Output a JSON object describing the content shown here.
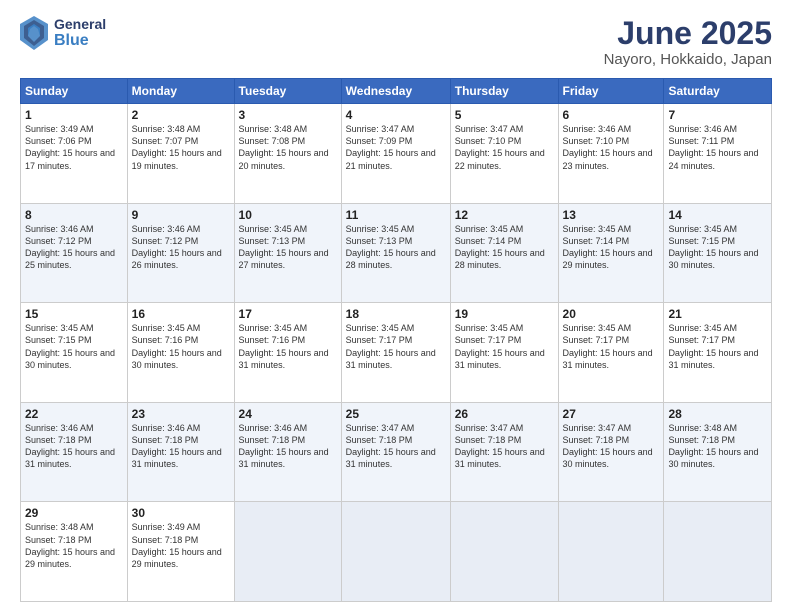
{
  "header": {
    "logo_general": "General",
    "logo_blue": "Blue",
    "title": "June 2025",
    "subtitle": "Nayoro, Hokkaido, Japan"
  },
  "calendar": {
    "days_of_week": [
      "Sunday",
      "Monday",
      "Tuesday",
      "Wednesday",
      "Thursday",
      "Friday",
      "Saturday"
    ],
    "weeks": [
      [
        null,
        {
          "day": 2,
          "info": "Sunrise: 3:48 AM\nSunset: 7:07 PM\nDaylight: 15 hours\nand 19 minutes."
        },
        {
          "day": 3,
          "info": "Sunrise: 3:48 AM\nSunset: 7:08 PM\nDaylight: 15 hours\nand 20 minutes."
        },
        {
          "day": 4,
          "info": "Sunrise: 3:47 AM\nSunset: 7:09 PM\nDaylight: 15 hours\nand 21 minutes."
        },
        {
          "day": 5,
          "info": "Sunrise: 3:47 AM\nSunset: 7:10 PM\nDaylight: 15 hours\nand 22 minutes."
        },
        {
          "day": 6,
          "info": "Sunrise: 3:46 AM\nSunset: 7:10 PM\nDaylight: 15 hours\nand 23 minutes."
        },
        {
          "day": 7,
          "info": "Sunrise: 3:46 AM\nSunset: 7:11 PM\nDaylight: 15 hours\nand 24 minutes."
        }
      ],
      [
        {
          "day": 1,
          "info": "Sunrise: 3:49 AM\nSunset: 7:06 PM\nDaylight: 15 hours\nand 17 minutes."
        },
        null,
        null,
        null,
        null,
        null,
        null
      ],
      [
        {
          "day": 8,
          "info": "Sunrise: 3:46 AM\nSunset: 7:12 PM\nDaylight: 15 hours\nand 25 minutes."
        },
        {
          "day": 9,
          "info": "Sunrise: 3:46 AM\nSunset: 7:12 PM\nDaylight: 15 hours\nand 26 minutes."
        },
        {
          "day": 10,
          "info": "Sunrise: 3:45 AM\nSunset: 7:13 PM\nDaylight: 15 hours\nand 27 minutes."
        },
        {
          "day": 11,
          "info": "Sunrise: 3:45 AM\nSunset: 7:13 PM\nDaylight: 15 hours\nand 28 minutes."
        },
        {
          "day": 12,
          "info": "Sunrise: 3:45 AM\nSunset: 7:14 PM\nDaylight: 15 hours\nand 28 minutes."
        },
        {
          "day": 13,
          "info": "Sunrise: 3:45 AM\nSunset: 7:14 PM\nDaylight: 15 hours\nand 29 minutes."
        },
        {
          "day": 14,
          "info": "Sunrise: 3:45 AM\nSunset: 7:15 PM\nDaylight: 15 hours\nand 30 minutes."
        }
      ],
      [
        {
          "day": 15,
          "info": "Sunrise: 3:45 AM\nSunset: 7:15 PM\nDaylight: 15 hours\nand 30 minutes."
        },
        {
          "day": 16,
          "info": "Sunrise: 3:45 AM\nSunset: 7:16 PM\nDaylight: 15 hours\nand 30 minutes."
        },
        {
          "day": 17,
          "info": "Sunrise: 3:45 AM\nSunset: 7:16 PM\nDaylight: 15 hours\nand 31 minutes."
        },
        {
          "day": 18,
          "info": "Sunrise: 3:45 AM\nSunset: 7:17 PM\nDaylight: 15 hours\nand 31 minutes."
        },
        {
          "day": 19,
          "info": "Sunrise: 3:45 AM\nSunset: 7:17 PM\nDaylight: 15 hours\nand 31 minutes."
        },
        {
          "day": 20,
          "info": "Sunrise: 3:45 AM\nSunset: 7:17 PM\nDaylight: 15 hours\nand 31 minutes."
        },
        {
          "day": 21,
          "info": "Sunrise: 3:45 AM\nSunset: 7:17 PM\nDaylight: 15 hours\nand 31 minutes."
        }
      ],
      [
        {
          "day": 22,
          "info": "Sunrise: 3:46 AM\nSunset: 7:18 PM\nDaylight: 15 hours\nand 31 minutes."
        },
        {
          "day": 23,
          "info": "Sunrise: 3:46 AM\nSunset: 7:18 PM\nDaylight: 15 hours\nand 31 minutes."
        },
        {
          "day": 24,
          "info": "Sunrise: 3:46 AM\nSunset: 7:18 PM\nDaylight: 15 hours\nand 31 minutes."
        },
        {
          "day": 25,
          "info": "Sunrise: 3:47 AM\nSunset: 7:18 PM\nDaylight: 15 hours\nand 31 minutes."
        },
        {
          "day": 26,
          "info": "Sunrise: 3:47 AM\nSunset: 7:18 PM\nDaylight: 15 hours\nand 31 minutes."
        },
        {
          "day": 27,
          "info": "Sunrise: 3:47 AM\nSunset: 7:18 PM\nDaylight: 15 hours\nand 30 minutes."
        },
        {
          "day": 28,
          "info": "Sunrise: 3:48 AM\nSunset: 7:18 PM\nDaylight: 15 hours\nand 30 minutes."
        }
      ],
      [
        {
          "day": 29,
          "info": "Sunrise: 3:48 AM\nSunset: 7:18 PM\nDaylight: 15 hours\nand 29 minutes."
        },
        {
          "day": 30,
          "info": "Sunrise: 3:49 AM\nSunset: 7:18 PM\nDaylight: 15 hours\nand 29 minutes."
        },
        null,
        null,
        null,
        null,
        null
      ]
    ]
  }
}
